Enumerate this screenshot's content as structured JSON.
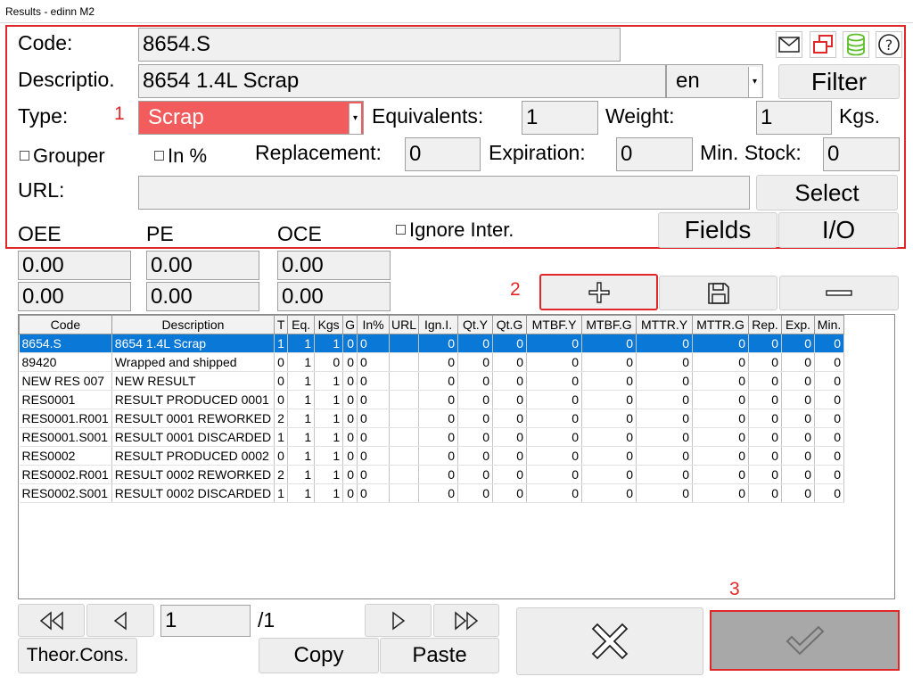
{
  "window": {
    "title": "Results - edinn M2"
  },
  "form": {
    "code_label": "Code:",
    "code_value": "8654.S",
    "description_label": "Descriptio.",
    "description_value": "8654 1.4L Scrap",
    "language_value": "en",
    "filter_label": "Filter",
    "type_label": "Type:",
    "type_value": "Scrap",
    "equivalents_label": "Equivalents:",
    "equivalents_value": "1",
    "weight_label": "Weight:",
    "weight_value": "1",
    "weight_unit": "Kgs.",
    "grouper_label": "Grouper",
    "in_percent_label": "In %",
    "replacement_label": "Replacement:",
    "replacement_value": "0",
    "expiration_label": "Expiration:",
    "expiration_value": "0",
    "min_stock_label": "Min. Stock:",
    "min_stock_value": "0",
    "url_label": "URL:",
    "url_value": "",
    "select_label": "Select",
    "oee_label": "OEE",
    "pe_label": "PE",
    "oce_label": "OCE",
    "ignore_inter_label": "Ignore Inter.",
    "fields_label": "Fields",
    "io_label": "I/O",
    "oee_1": "0.00",
    "oee_2": "0.00",
    "pe_1": "0.00",
    "pe_2": "0.00",
    "oce_1": "0.00",
    "oce_2": "0.00"
  },
  "annotations": {
    "a1": "1",
    "a2": "2",
    "a3": "3"
  },
  "table": {
    "headers": [
      "Code",
      "Description",
      "T",
      "Eq.",
      "Kgs",
      "G",
      "In%",
      "URL",
      "Ign.I.",
      "Qt.Y",
      "Qt.G",
      "MTBF.Y",
      "MTBF.G",
      "MTTR.Y",
      "MTTR.G",
      "Rep.",
      "Exp.",
      "Min."
    ],
    "rows": [
      [
        "8654.S",
        "8654 1.4L Scrap",
        "1",
        "1",
        "1",
        "0",
        "0",
        "",
        "0",
        "0",
        "0",
        "0",
        "0",
        "0",
        "0",
        "0",
        "0",
        "0"
      ],
      [
        "89420",
        "Wrapped and shipped",
        "0",
        "1",
        "0",
        "0",
        "0",
        "",
        "0",
        "0",
        "0",
        "0",
        "0",
        "0",
        "0",
        "0",
        "0",
        "0"
      ],
      [
        "NEW RES 007",
        "NEW RESULT",
        "0",
        "1",
        "1",
        "0",
        "0",
        "",
        "0",
        "0",
        "0",
        "0",
        "0",
        "0",
        "0",
        "0",
        "0",
        "0"
      ],
      [
        "RES0001",
        "RESULT PRODUCED 0001",
        "0",
        "1",
        "1",
        "0",
        "0",
        "",
        "0",
        "0",
        "0",
        "0",
        "0",
        "0",
        "0",
        "0",
        "0",
        "0"
      ],
      [
        "RES0001.R001",
        "RESULT 0001 REWORKED",
        "2",
        "1",
        "1",
        "0",
        "0",
        "",
        "0",
        "0",
        "0",
        "0",
        "0",
        "0",
        "0",
        "0",
        "0",
        "0"
      ],
      [
        "RES0001.S001",
        "RESULT 0001 DISCARDED",
        "1",
        "1",
        "1",
        "0",
        "0",
        "",
        "0",
        "0",
        "0",
        "0",
        "0",
        "0",
        "0",
        "0",
        "0",
        "0"
      ],
      [
        "RES0002",
        "RESULT PRODUCED 0002",
        "0",
        "1",
        "1",
        "0",
        "0",
        "",
        "0",
        "0",
        "0",
        "0",
        "0",
        "0",
        "0",
        "0",
        "0",
        "0"
      ],
      [
        "RES0002.R001",
        "RESULT 0002 REWORKED",
        "2",
        "1",
        "1",
        "0",
        "0",
        "",
        "0",
        "0",
        "0",
        "0",
        "0",
        "0",
        "0",
        "0",
        "0",
        "0"
      ],
      [
        "RES0002.S001",
        "RESULT 0002 DISCARDED",
        "1",
        "1",
        "1",
        "0",
        "0",
        "",
        "0",
        "0",
        "0",
        "0",
        "0",
        "0",
        "0",
        "0",
        "0",
        "0"
      ]
    ]
  },
  "pager": {
    "page_value": "1",
    "page_total": "/1"
  },
  "footer": {
    "theor_cons_label": "Theor.Cons.",
    "copy_label": "Copy",
    "paste_label": "Paste"
  },
  "icons": [
    "mail-icon",
    "windows-icon",
    "database-icon",
    "help-icon",
    "plus-icon",
    "save-icon",
    "minus-icon",
    "first-page-icon",
    "prev-page-icon",
    "next-page-icon",
    "last-page-icon",
    "cancel-icon",
    "confirm-icon"
  ],
  "colors": {
    "annotation_red": "#e02828",
    "type_field_bg": "#f25c5c",
    "selected_row": "#0a78d7",
    "db_green": "#5cbf2a"
  }
}
